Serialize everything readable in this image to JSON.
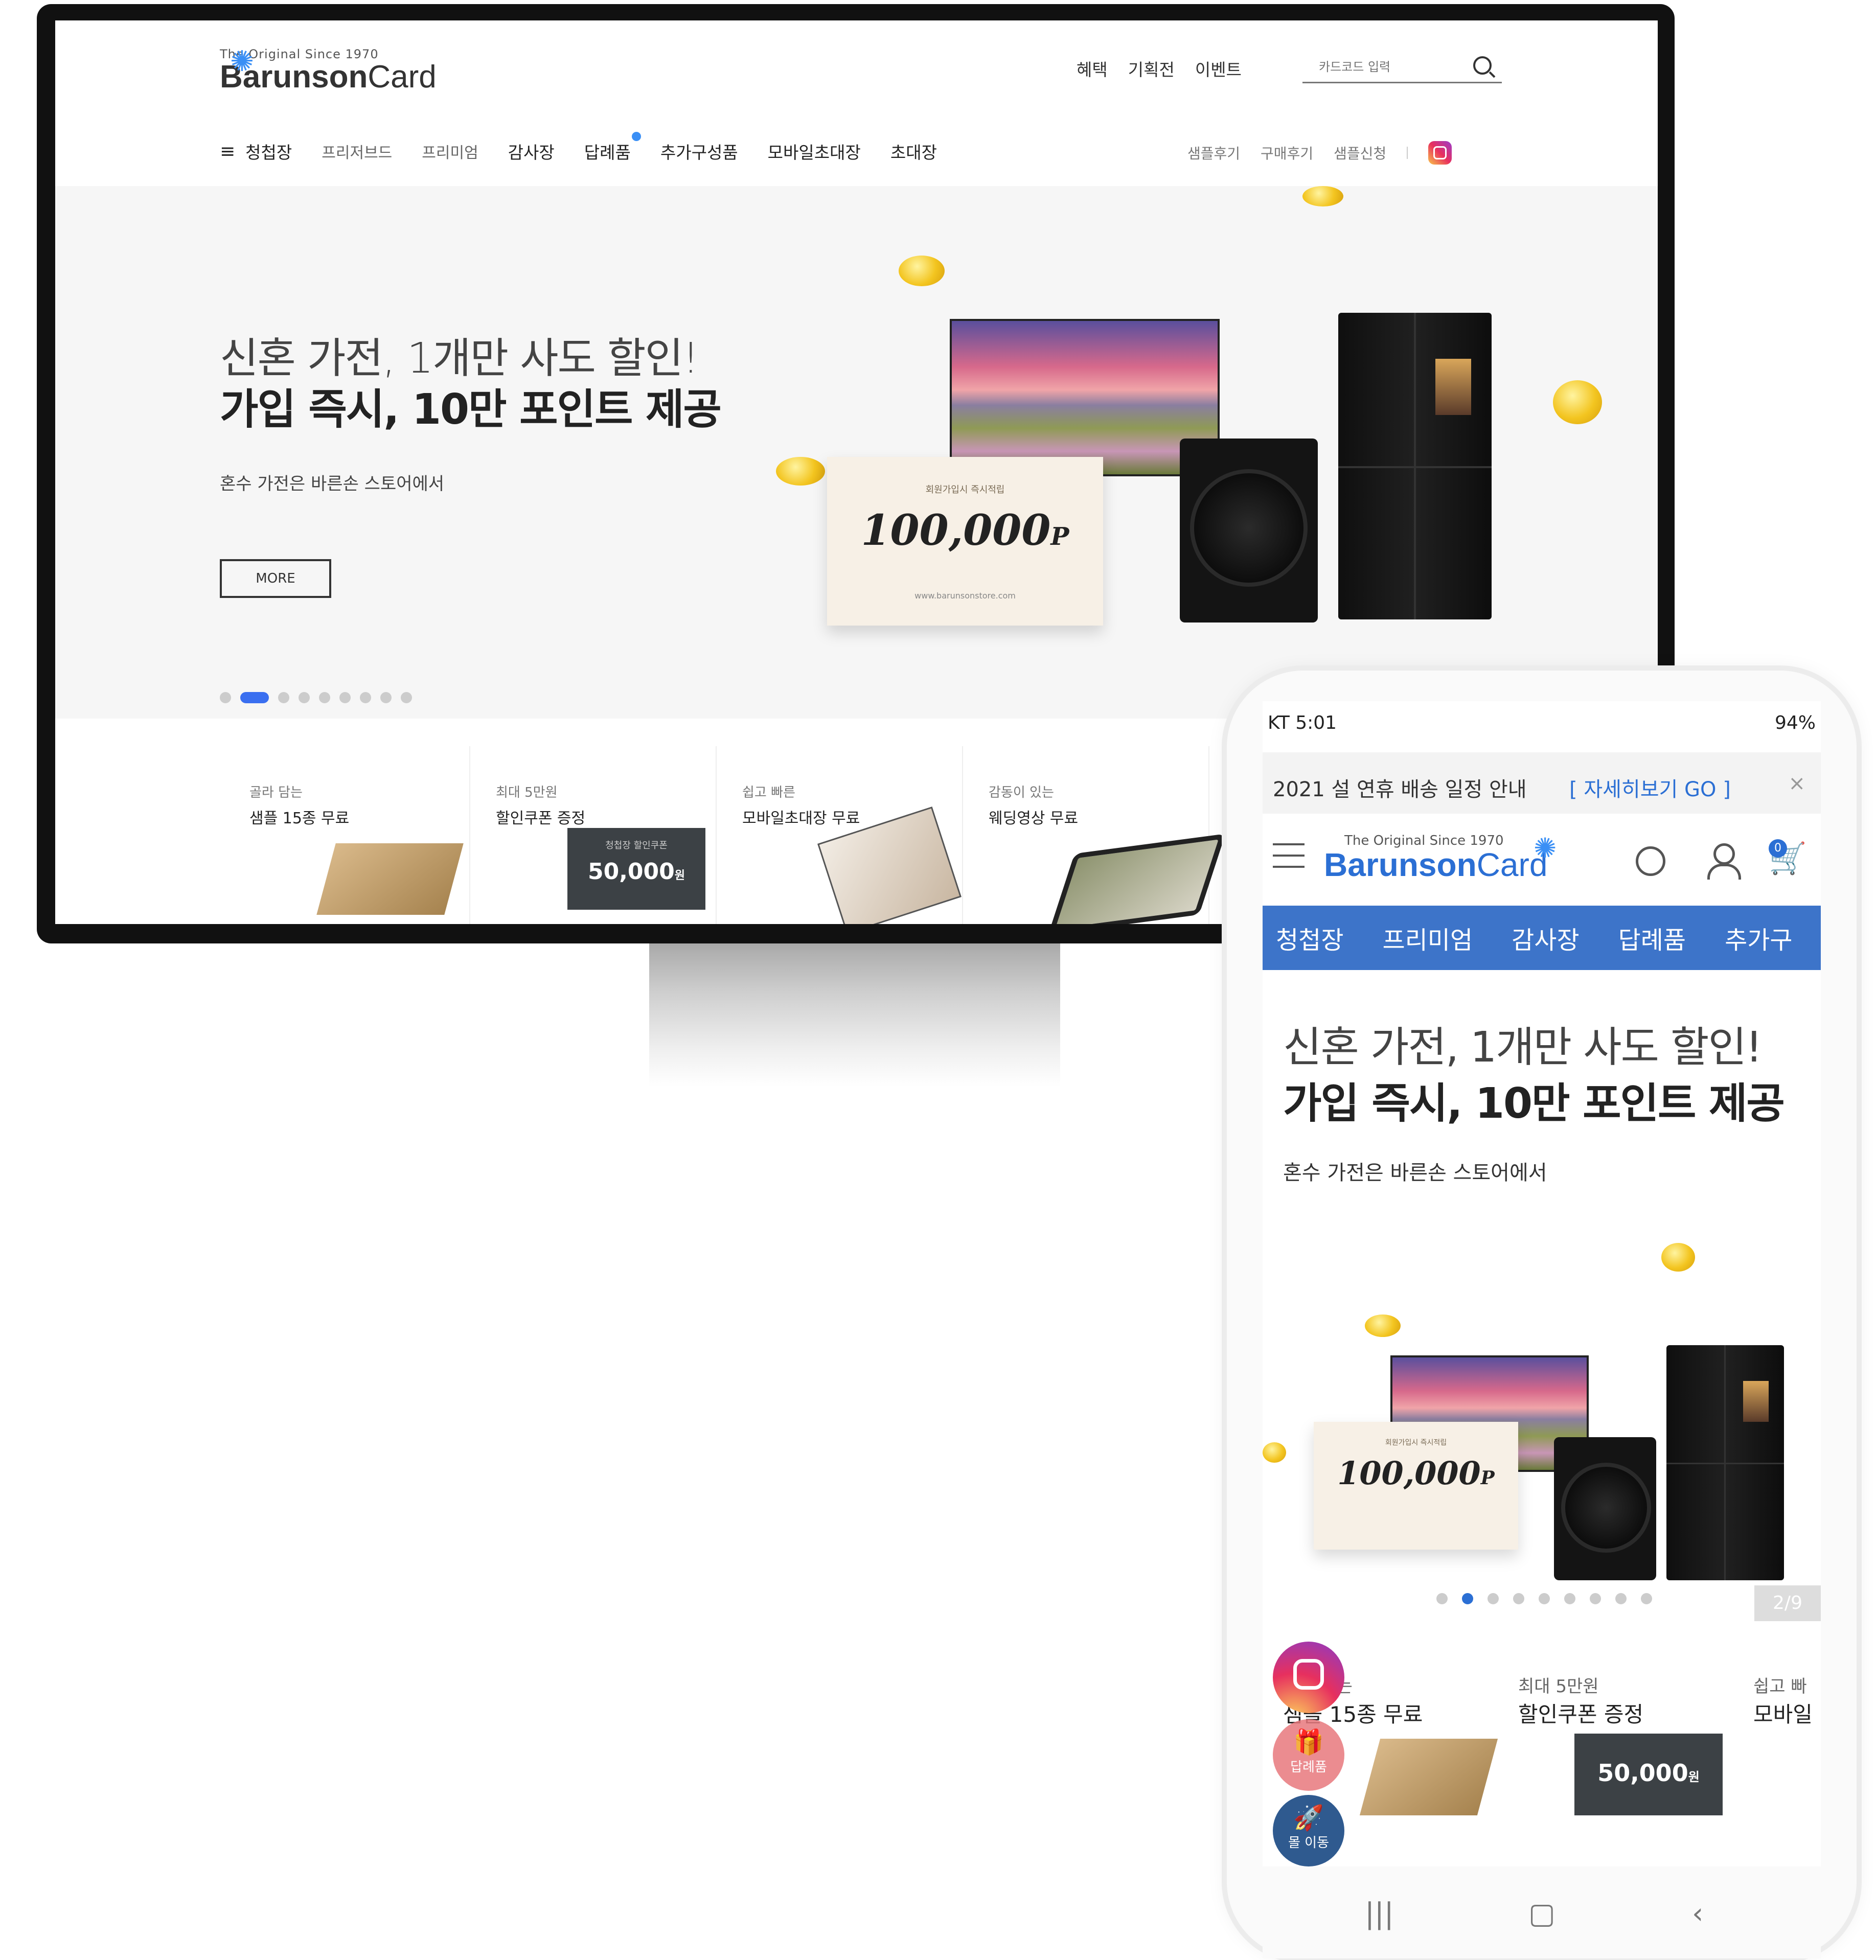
{
  "desktop": {
    "logo": {
      "since": "The Original Since 1970",
      "brand_bold": "Barunson",
      "brand_light": "Card"
    },
    "top_links": [
      "혜택",
      "기획전",
      "이벤트"
    ],
    "search": {
      "placeholder": "카드코드 입력"
    },
    "nav": [
      "청첩장",
      "프리저브드",
      "프리미엄",
      "감사장",
      "답례품",
      "추가구성품",
      "모바일초대장",
      "초대장"
    ],
    "sub_nav": [
      "샘플후기",
      "구매후기",
      "샘플신청"
    ],
    "hero": {
      "line1": "신혼 가전, 1개만 사도 할인!",
      "line2": "가입 즉시, 10만 포인트 제공",
      "sub": "혼수 가전은 바른손 스토어에서",
      "more": "MORE",
      "slide_count": 9,
      "active_slide": 2,
      "ticket_top": "회원가입시 즉시적립",
      "ticket_value": "100,000",
      "ticket_unit": "P",
      "ticket_url": "www.barunsonstore.com"
    },
    "cards": [
      {
        "small": "골라 담는",
        "big": "샘플 15종 무료"
      },
      {
        "small": "최대 5만원",
        "big": "할인쿠폰 증정",
        "coupon_top": "청첩장 할인쿠폰",
        "coupon_value": "50,000",
        "coupon_unit": "원"
      },
      {
        "small": "쉽고 빠른",
        "big": "모바일초대장 무료"
      },
      {
        "small": "감동이 있는",
        "big": "웨딩영상 무료"
      }
    ]
  },
  "mobile": {
    "status": {
      "left": "KT 5:01",
      "right": "94%"
    },
    "notice": {
      "text": "2021 설 연휴 배송 일정 안내",
      "link": "[ 자세히보기 GO ]",
      "close": "×"
    },
    "logo": {
      "since": "The Original Since 1970",
      "brand_bold": "Barunson",
      "brand_light": "Card"
    },
    "cart_count": "0",
    "tabs": [
      "청첩장",
      "프리미엄",
      "감사장",
      "답례품",
      "추가구"
    ],
    "hero": {
      "line1": "신혼 가전, 1개만 사도 할인!",
      "line2": "가입 즉시, 10만 포인트 제공",
      "sub": "혼수 가전은 바른손 스토어에서",
      "ticket_top": "회원가입시 즉시적립",
      "ticket_value": "100,000",
      "ticket_unit": "P",
      "pager": "2/9"
    },
    "cards": [
      {
        "small": "골라 담는",
        "big": "샘플 15종 무료"
      },
      {
        "small": "최대 5만원",
        "big": "할인쿠폰 증정",
        "coupon_value": "50,000",
        "coupon_unit": "원"
      },
      {
        "small": "쉽고 빠",
        "big": "모바일"
      }
    ],
    "floating": {
      "gift_label": "답례품",
      "mall_label": "몰 이동"
    }
  },
  "colors": {
    "accent_blue": "#3a6ff0",
    "mobile_tab_bg": "#3d74c9",
    "link_blue": "#2b6fd4"
  }
}
